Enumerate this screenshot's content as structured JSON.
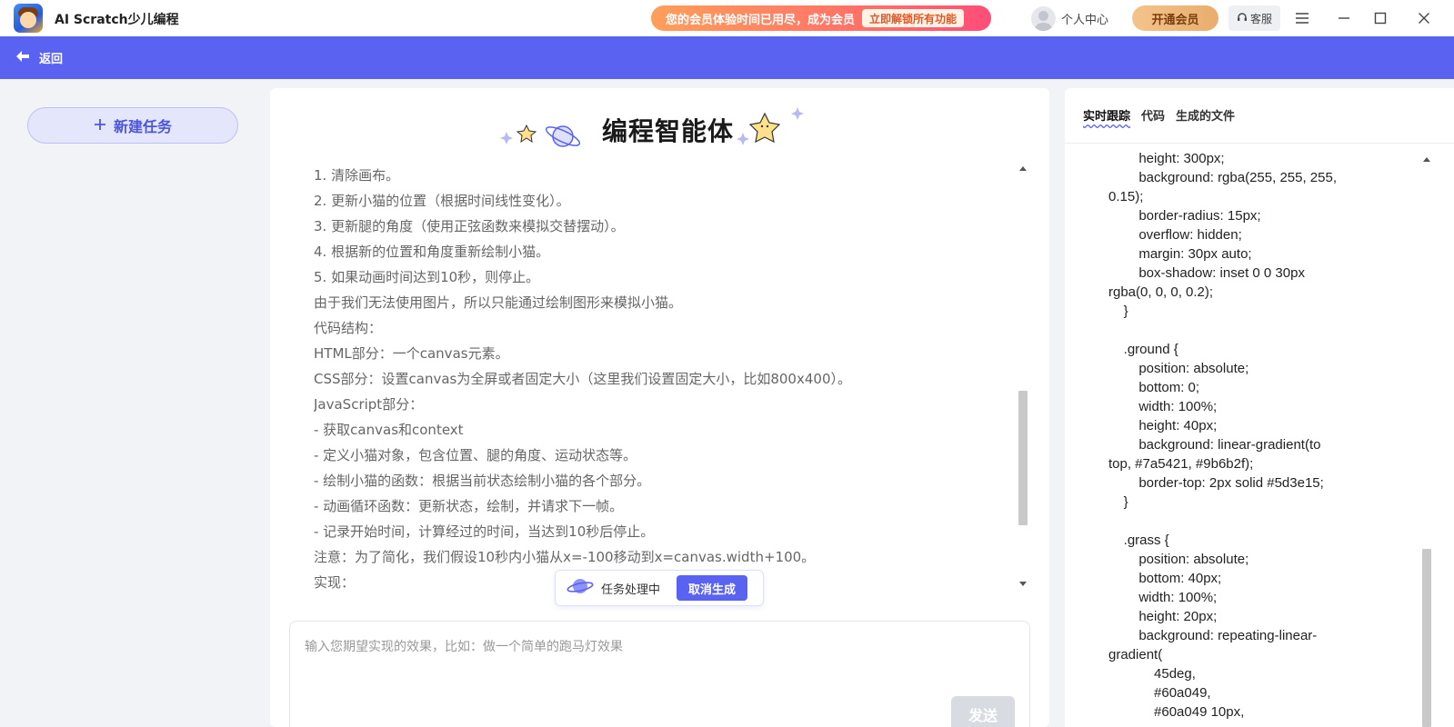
{
  "window": {
    "app_title": "AI Scratch少儿编程",
    "promo_text": "您的会员体验时间已用尽，成为会员",
    "promo_button": "立即解锁所有功能",
    "user_label": "个人中心",
    "vip_button": "开通会员",
    "service_label": "客服"
  },
  "nav": {
    "back_label": "返回"
  },
  "sidebar": {
    "new_task_label": "新建任务"
  },
  "center": {
    "agent_title": "编程智能体",
    "messages": [
      "1. 清除画布。",
      "2. 更新小猫的位置（根据时间线性变化）。",
      "3. 更新腿的角度（使用正弦函数来模拟交替摆动）。",
      "4. 根据新的位置和角度重新绘制小猫。",
      "5. 如果动画时间达到10秒，则停止。",
      "由于我们无法使用图片，所以只能通过绘制图形来模拟小猫。",
      "代码结构：",
      "HTML部分：一个canvas元素。",
      "CSS部分：设置canvas为全屏或者固定大小（这里我们设置固定大小，比如800x400）。",
      "JavaScript部分：",
      "- 获取canvas和context",
      "- 定义小猫对象，包含位置、腿的角度、运动状态等。",
      "- 绘制小猫的函数：根据当前状态绘制小猫的各个部分。",
      "- 动画循环函数：更新状态，绘制，并请求下一帧。",
      "- 记录开始时间，计算经过的时间，当达到10秒后停止。",
      "注意：为了简化，我们假设10秒内小猫从x=-100移动到x=canvas.width+100。",
      "实现："
    ],
    "status_text": "任务处理中",
    "cancel_button": "取消生成",
    "input_placeholder": "输入您期望实现的效果，比如：做一个简单的跑马灯效果",
    "send_button": "发送"
  },
  "right": {
    "tabs": [
      "实时跟踪",
      "代码",
      "生成的文件"
    ],
    "active_tab": "实时跟踪",
    "code_lines": [
      "        height: 300px;",
      "        background: rgba(255, 255, 255,",
      "0.15);",
      "        border-radius: 15px;",
      "        overflow: hidden;",
      "        margin: 30px auto;",
      "        box-shadow: inset 0 0 30px",
      "rgba(0, 0, 0, 0.2);",
      "    }",
      "",
      "    .ground {",
      "        position: absolute;",
      "        bottom: 0;",
      "        width: 100%;",
      "        height: 40px;",
      "        background: linear-gradient(to",
      "top, #7a5421, #9b6b2f);",
      "        border-top: 2px solid #5d3e15;",
      "    }",
      "",
      "    .grass {",
      "        position: absolute;",
      "        bottom: 40px;",
      "        width: 100%;",
      "        height: 20px;",
      "        background: repeating-linear-",
      "gradient(",
      "            45deg,",
      "            #60a049,",
      "            #60a049 10px,"
    ]
  },
  "colors": {
    "accent": "#5a62f2",
    "vip": "#e9ad6d",
    "promo_start": "#ff9f5a",
    "promo_end": "#ff4d79"
  },
  "icons": {
    "logo": "app-logo",
    "back": "arrow-left-icon",
    "plus": "plus-icon",
    "headset": "headset-icon",
    "menu": "menu-icon",
    "minimize": "minimize-icon",
    "maximize": "maximize-icon",
    "close": "close-icon",
    "planet": "planet-icon"
  }
}
